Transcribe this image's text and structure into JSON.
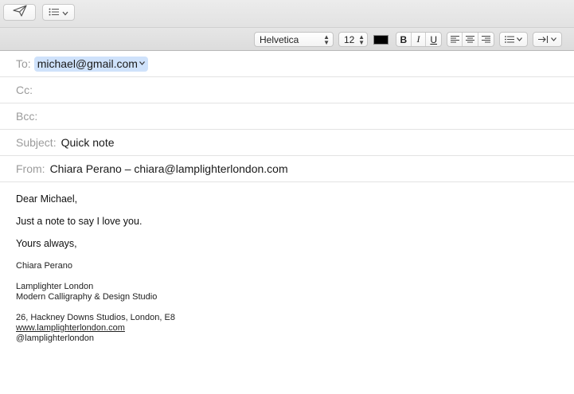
{
  "toolbar": {
    "send_icon": "paper-plane-icon",
    "header_fields_icon": "list-icon"
  },
  "format": {
    "font": "Helvetica",
    "size": "12",
    "color": "#000000",
    "bold": "B",
    "italic": "I",
    "underline": "U"
  },
  "header": {
    "to_label": "To:",
    "to_value": "michael@gmail.com",
    "cc_label": "Cc:",
    "bcc_label": "Bcc:",
    "subject_label": "Subject:",
    "subject_value": "Quick note",
    "from_label": "From:",
    "from_value": "Chiara Perano – chiara@lamplighterlondon.com"
  },
  "body": {
    "greeting": "Dear Michael,",
    "line1": "Just a note to say I love you.",
    "closing": "Yours always,",
    "sig_name": "Chiara Perano",
    "sig_company": "Lamplighter London",
    "sig_tagline": "Modern Calligraphy & Design Studio",
    "sig_address": "26, Hackney Downs Studios, London, E8",
    "sig_website": "www.lamplighterlondon.com",
    "sig_handle": "@lamplighterlondon"
  }
}
